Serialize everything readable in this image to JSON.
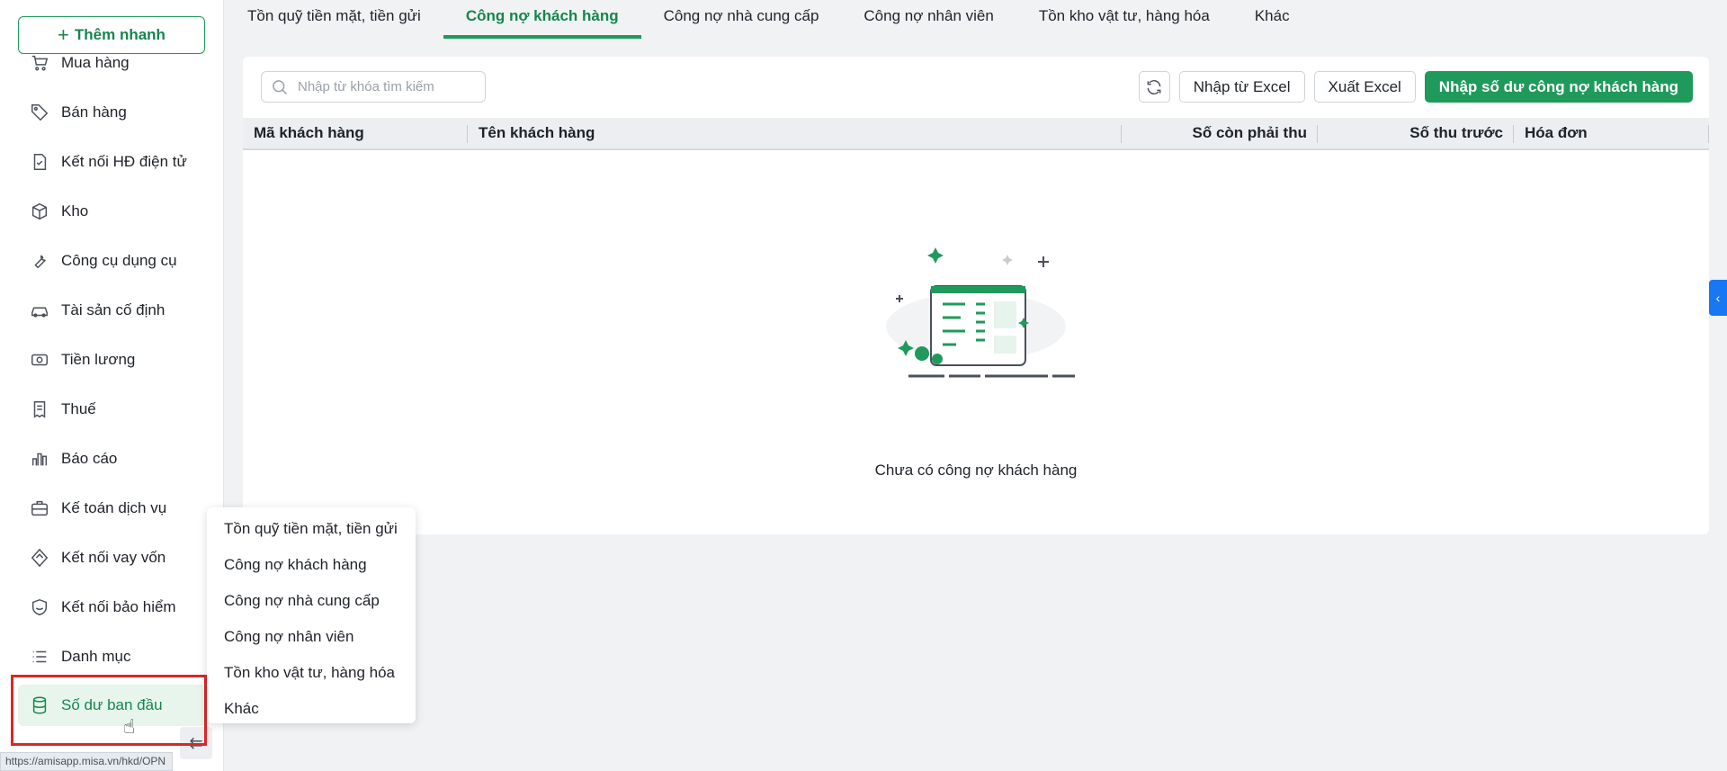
{
  "sidebar": {
    "quick_add_label": "Thêm nhanh",
    "items": [
      {
        "label": "Mua hàng",
        "icon": "cart-icon"
      },
      {
        "label": "Bán hàng",
        "icon": "tag-icon"
      },
      {
        "label": "Kết nối HĐ điện tử",
        "icon": "document-check-icon"
      },
      {
        "label": "Kho",
        "icon": "box-icon"
      },
      {
        "label": "Công cụ dụng cụ",
        "icon": "wrench-icon"
      },
      {
        "label": "Tài sản cố định",
        "icon": "car-icon"
      },
      {
        "label": "Tiền lương",
        "icon": "money-icon"
      },
      {
        "label": "Thuế",
        "icon": "receipt-icon"
      },
      {
        "label": "Báo cáo",
        "icon": "bar-chart-icon"
      },
      {
        "label": "Kế toán dịch vụ",
        "icon": "briefcase-icon"
      },
      {
        "label": "Kết nối vay vốn",
        "icon": "loan-icon"
      },
      {
        "label": "Kết nối bảo hiểm",
        "icon": "shield-icon"
      },
      {
        "label": "Danh mục",
        "icon": "list-icon"
      },
      {
        "label": "Số dư ban đầu",
        "icon": "database-icon",
        "active": true
      }
    ],
    "status_url": "https://amisapp.misa.vn/hkd/OPN"
  },
  "tabs": [
    {
      "label": "Tồn quỹ tiền mặt, tiền gửi"
    },
    {
      "label": "Công nợ khách hàng",
      "active": true
    },
    {
      "label": "Công nợ nhà cung cấp"
    },
    {
      "label": "Công nợ nhân viên"
    },
    {
      "label": "Tồn kho vật tư, hàng hóa"
    },
    {
      "label": "Khác"
    }
  ],
  "search": {
    "placeholder": "Nhập từ khóa tìm kiếm"
  },
  "toolbar": {
    "import_label": "Nhập từ Excel",
    "export_label": "Xuất Excel",
    "primary_label": "Nhập số dư công nợ khách hàng"
  },
  "table": {
    "columns": [
      "Mã khách hàng",
      "Tên khách hàng",
      "Số còn phải thu",
      "Số thu trước",
      "Hóa đơn"
    ]
  },
  "empty_message": "Chưa có công nợ khách hàng",
  "menu": {
    "items": [
      "Tồn quỹ tiền mặt, tiền gửi",
      "Công nợ khách hàng",
      "Công nợ nhà cung cấp",
      "Công nợ nhân viên",
      "Tồn kho vật tư, hàng hóa",
      "Khác"
    ]
  },
  "colors": {
    "accent": "#1f9a5b",
    "highlight": "#e02424"
  }
}
